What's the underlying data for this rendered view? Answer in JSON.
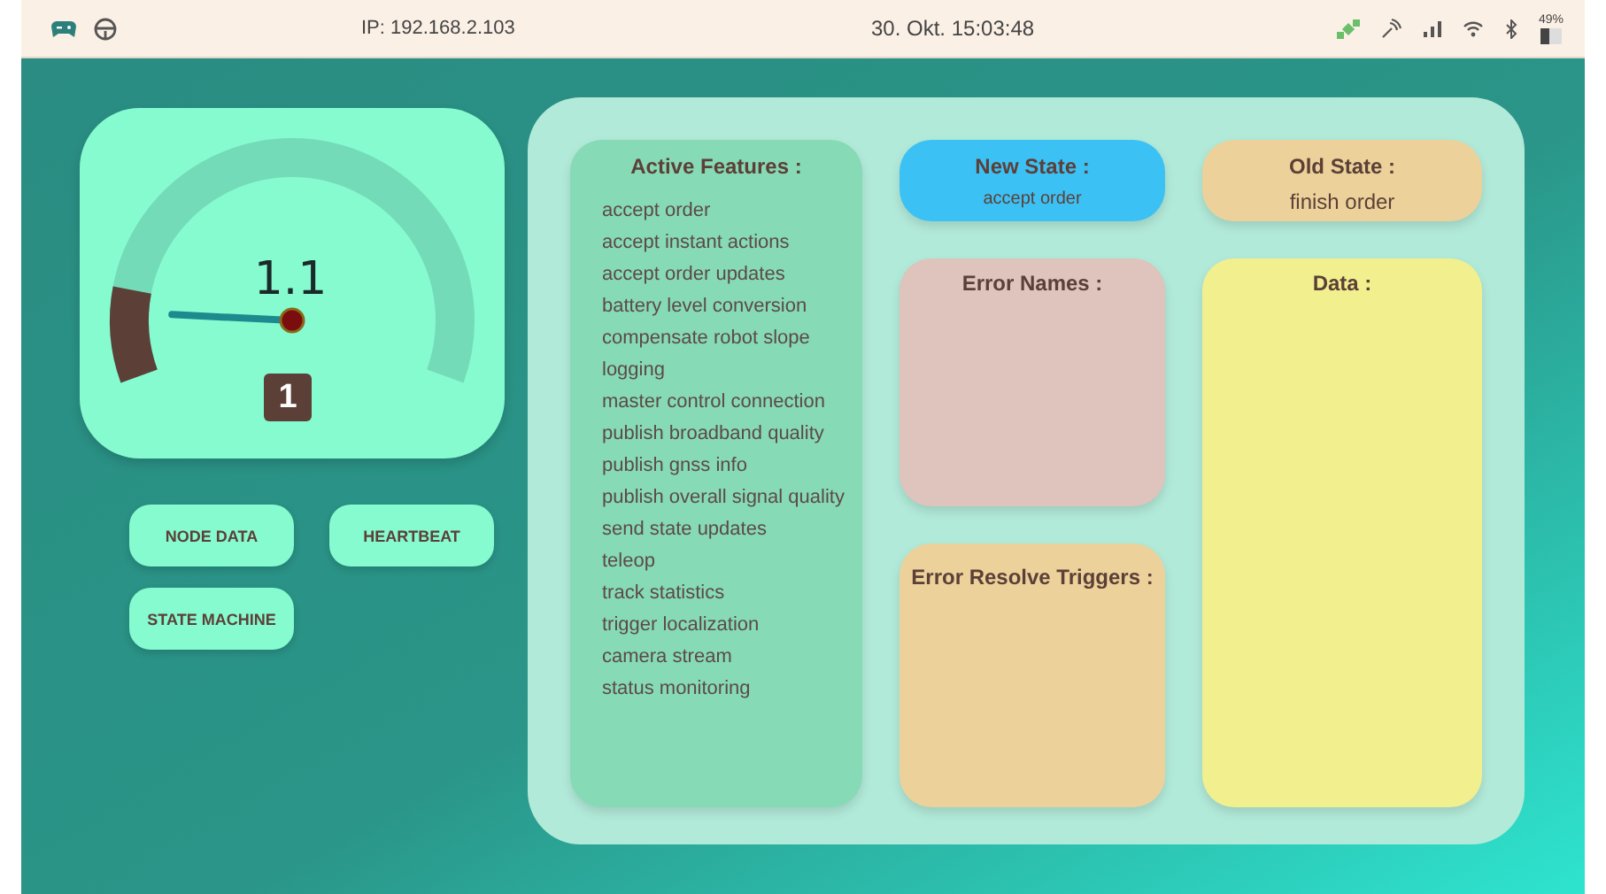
{
  "status_bar": {
    "ip": "IP: 192.168.2.103",
    "datetime": "30. Okt. 15:03:48",
    "battery": "49%"
  },
  "gauge": {
    "value": "1.1",
    "level": 0.14,
    "badge": "1"
  },
  "buttons": [
    "NODE DATA",
    "HEARTBEAT",
    "STATE MACHINE"
  ],
  "active_features": {
    "title": "Active Features :",
    "items": [
      "accept order",
      "accept instant actions",
      "accept order updates",
      "battery level conversion",
      "compensate robot slope",
      "logging",
      "master control connection",
      "publish broadband quality",
      "publish gnss info",
      "publish overall signal quality",
      "send state updates",
      "teleop",
      "track statistics",
      "trigger localization",
      "camera stream",
      "status monitoring"
    ]
  },
  "new_state": {
    "title": "New State :",
    "value": "accept order"
  },
  "old_state": {
    "title": "Old State :",
    "value": "finish order"
  },
  "error_names": {
    "title": "Error Names :"
  },
  "data": {
    "title": "Data :"
  },
  "error_resolve_triggers": {
    "title": "Error Resolve Triggers :"
  }
}
